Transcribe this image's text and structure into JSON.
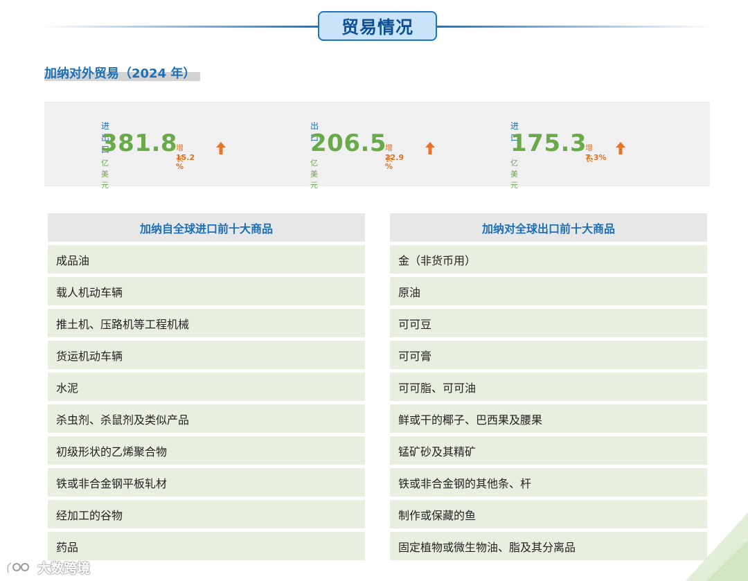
{
  "section_title": "贸易情况",
  "subtitle": "加纳对外贸易（2024 年）",
  "stats": [
    {
      "label": "进出口",
      "value": "381.8",
      "unit": "亿美元",
      "growth_label": "增长",
      "growth_value": "15.2 %"
    },
    {
      "label": "出口",
      "value": "206.5",
      "unit": "亿美元",
      "growth_label": "增长",
      "growth_value": "22.9 %"
    },
    {
      "label": "进口",
      "value": "175.3",
      "unit": "亿美元",
      "growth_label": "增长",
      "growth_value": "7.3%"
    }
  ],
  "imports": {
    "header": "加纳自全球进口前十大商品",
    "items": [
      "成品油",
      "载人机动车辆",
      "推土机、压路机等工程机械",
      "货运机动车辆",
      "水泥",
      "杀虫剂、杀鼠剂及类似产品",
      "初级形状的乙烯聚合物",
      "铁或非合金钢平板轧材",
      "经加工的谷物",
      "药品"
    ]
  },
  "exports": {
    "header": "加纳对全球出口前十大商品",
    "items": [
      "金（非货币用）",
      "原油",
      "可可豆",
      "可可膏",
      "可可脂、可可油",
      "鲜或干的椰子、巴西果及腰果",
      "锰矿砂及其精矿",
      "铁或非合金钢的其他条、杆",
      "制作或保藏的鱼",
      "固定植物或微生物油、脂及其分离品"
    ]
  },
  "watermark": "大数跨境",
  "colors": {
    "accent_blue": "#1d6fb8",
    "value_green": "#6aaa4a",
    "growth_orange": "#e0711f",
    "row_bg": "#e8efe0"
  },
  "icons": {
    "growth": "up-arrow-icon",
    "watermark_logo": "logo-icon"
  }
}
